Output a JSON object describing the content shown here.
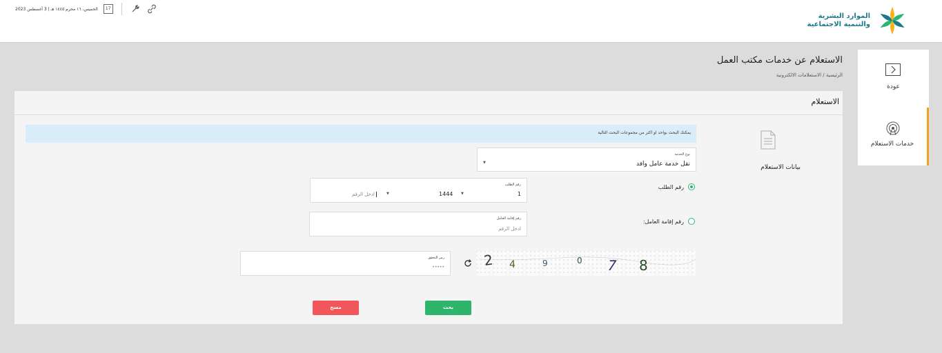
{
  "header": {
    "logo": {
      "line1": "الموارد البشرية",
      "line2": "والتنمية الاجتماعية"
    },
    "date_text": "الخميس، ١٦ محرم ١٤٤٥ هـ | 3 أغسطس 2023",
    "calendar_day": "17",
    "icons": [
      "calendar-icon",
      "tools-icon",
      "link-icon"
    ]
  },
  "sidebar": {
    "items": [
      {
        "label": "عودة",
        "icon": "back-arrow-icon"
      },
      {
        "label": "خدمات الاستعلام",
        "icon": "broadcast-icon"
      }
    ]
  },
  "page": {
    "title": "الاستعلام عن خدمات مكتب العمل",
    "breadcrumb": "الرئيسية / الاستعلامات الالكترونية"
  },
  "card": {
    "title": "الاستعلام",
    "nav_label": "بيانات الاستعلام",
    "info_text": "يمكنك البحث بواحد او اكثر من مجموعات البحث التالية",
    "service_type": {
      "label": "نوع الخدمة",
      "value": "نقل خدمة عامل وافد"
    },
    "request_number": {
      "radio_label": "رقم الطلب",
      "label": "رقم الطلب",
      "part1": "1",
      "part2": "1444",
      "placeholder": "ادخل الرقم"
    },
    "iqama_number": {
      "radio_label": "رقم إقامة العامل:",
      "label": "رقم إقامة العامل",
      "placeholder": "ادخل الرقم"
    },
    "captcha": {
      "label": "رمز التحقق",
      "placeholder": "•••••",
      "image_text": "2 4 9 0 7 8"
    },
    "buttons": {
      "search": "بحث",
      "clear": "مسح"
    },
    "colors": {
      "primary": "#2eb56b",
      "danger": "#f1575a",
      "accent": "#f0a21e",
      "info_bg": "#d9ecf9"
    }
  }
}
